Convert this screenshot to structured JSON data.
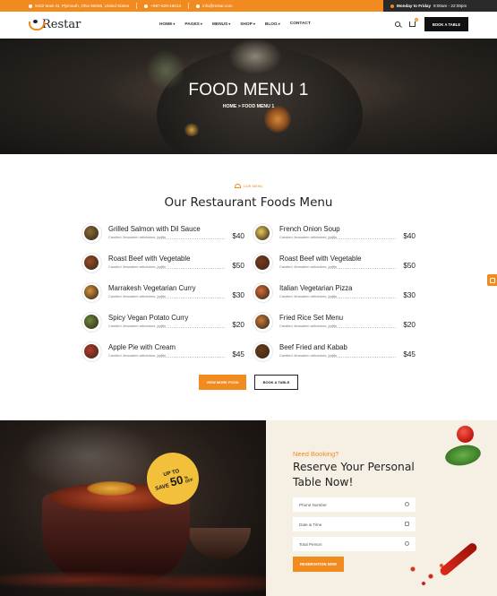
{
  "topbar": {
    "address": "9402 Main St, Plymouth, Ohio 95066, United States",
    "phone": "+987-629-18013",
    "email": "info@restar.com",
    "hours_label": "Monday to Friday",
    "hours_value": "9:00am - 22:00pm"
  },
  "nav": {
    "logo": "Restar",
    "items": [
      {
        "label": "HOME",
        "caret": "▾"
      },
      {
        "label": "PAGES",
        "caret": "▾"
      },
      {
        "label": "MENUS",
        "caret": "▾"
      },
      {
        "label": "SHOP",
        "caret": "▾"
      },
      {
        "label": "BLOG",
        "caret": "▾"
      },
      {
        "label": "CONTACT",
        "caret": ""
      }
    ],
    "cart_count": "0",
    "book_button": "BOOK A TABLE"
  },
  "hero": {
    "title": "FOOD MENU 1",
    "breadcrumb": "HOME > FOOD MENU 1"
  },
  "menu_section": {
    "tag": "OUR MENU",
    "title": "Our Restaurant Foods Menu",
    "dishes": [
      {
        "name": "Grilled Salmon with Dil Sauce",
        "desc": "Candied Jerusalem artichokes, truffle",
        "price": "$40",
        "color": "#8a6a3a"
      },
      {
        "name": "French Onion Soup",
        "desc": "Candied Jerusalem artichokes, truffle",
        "price": "$40",
        "color": "#e8c85a"
      },
      {
        "name": "Roast Beef with Vegetable",
        "desc": "Candied Jerusalem artichokes, truffle",
        "price": "$50",
        "color": "#9a4a2a"
      },
      {
        "name": "Roast Beef with Vegetable",
        "desc": "Candied Jerusalem artichokes, truffle",
        "price": "$50",
        "color": "#7a3a1a"
      },
      {
        "name": "Marrakesh Vegetarian Curry",
        "desc": "Candied Jerusalem artichokes, truffle",
        "price": "$30",
        "color": "#d8923a"
      },
      {
        "name": "Italian Vegetarian Pizza",
        "desc": "Candied Jerusalem artichokes, truffle",
        "price": "$30",
        "color": "#d86a3a"
      },
      {
        "name": "Spicy Vegan Potato Curry",
        "desc": "Candied Jerusalem artichokes, truffle",
        "price": "$20",
        "color": "#6a8a3a"
      },
      {
        "name": "Fried Rice Set Menu",
        "desc": "Candied Jerusalem artichokes, truffle",
        "price": "$20",
        "color": "#c87a3a"
      },
      {
        "name": "Apple Pie with Cream",
        "desc": "Candied Jerusalem artichokes, truffle",
        "price": "$45",
        "color": "#b83a2a"
      },
      {
        "name": "Beef Fried and Kabab",
        "desc": "Candied Jerusalem artichokes, truffle",
        "price": "$45",
        "color": "#6a3a1a"
      }
    ],
    "view_more": "VIEW MORE FOOD",
    "book_table": "BOOK A TABLE"
  },
  "promo": {
    "line1": "UP TO",
    "save": "SAVE",
    "percent": "50",
    "pct_sign": "%",
    "off": "OFF"
  },
  "booking": {
    "kicker": "Need Booking?",
    "title": "Reserve Your Personal Table Now!",
    "phone_placeholder": "Phone Number",
    "datetime_placeholder": "Date & Time",
    "persons_placeholder": "Total Person",
    "submit": "RESERVATION NOW"
  },
  "colors": {
    "accent": "#f18a1f",
    "dark": "#111111",
    "cream": "#f6efe4"
  }
}
